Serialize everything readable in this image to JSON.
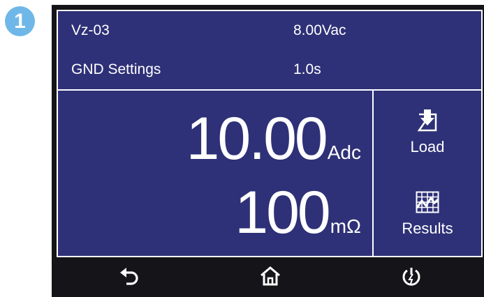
{
  "badge": {
    "number": "1",
    "color": "#6fb7e8"
  },
  "header": {
    "rows": [
      {
        "label": "Vz-03",
        "value": "8.00Vac"
      },
      {
        "label": "GND Settings",
        "value": "1.0s"
      }
    ]
  },
  "readings": [
    {
      "value": "10.00",
      "unit": "Adc"
    },
    {
      "value": "100",
      "unit": "mΩ"
    }
  ],
  "side_buttons": [
    {
      "label": "Load",
      "icon": "load-icon"
    },
    {
      "label": "Results",
      "icon": "results-icon"
    }
  ],
  "bottom_bar": [
    {
      "icon": "back-icon"
    },
    {
      "icon": "home-icon"
    },
    {
      "icon": "power-icon"
    }
  ],
  "colors": {
    "screen": "#2e3177",
    "bezel": "#151519",
    "text": "#ffffff"
  }
}
